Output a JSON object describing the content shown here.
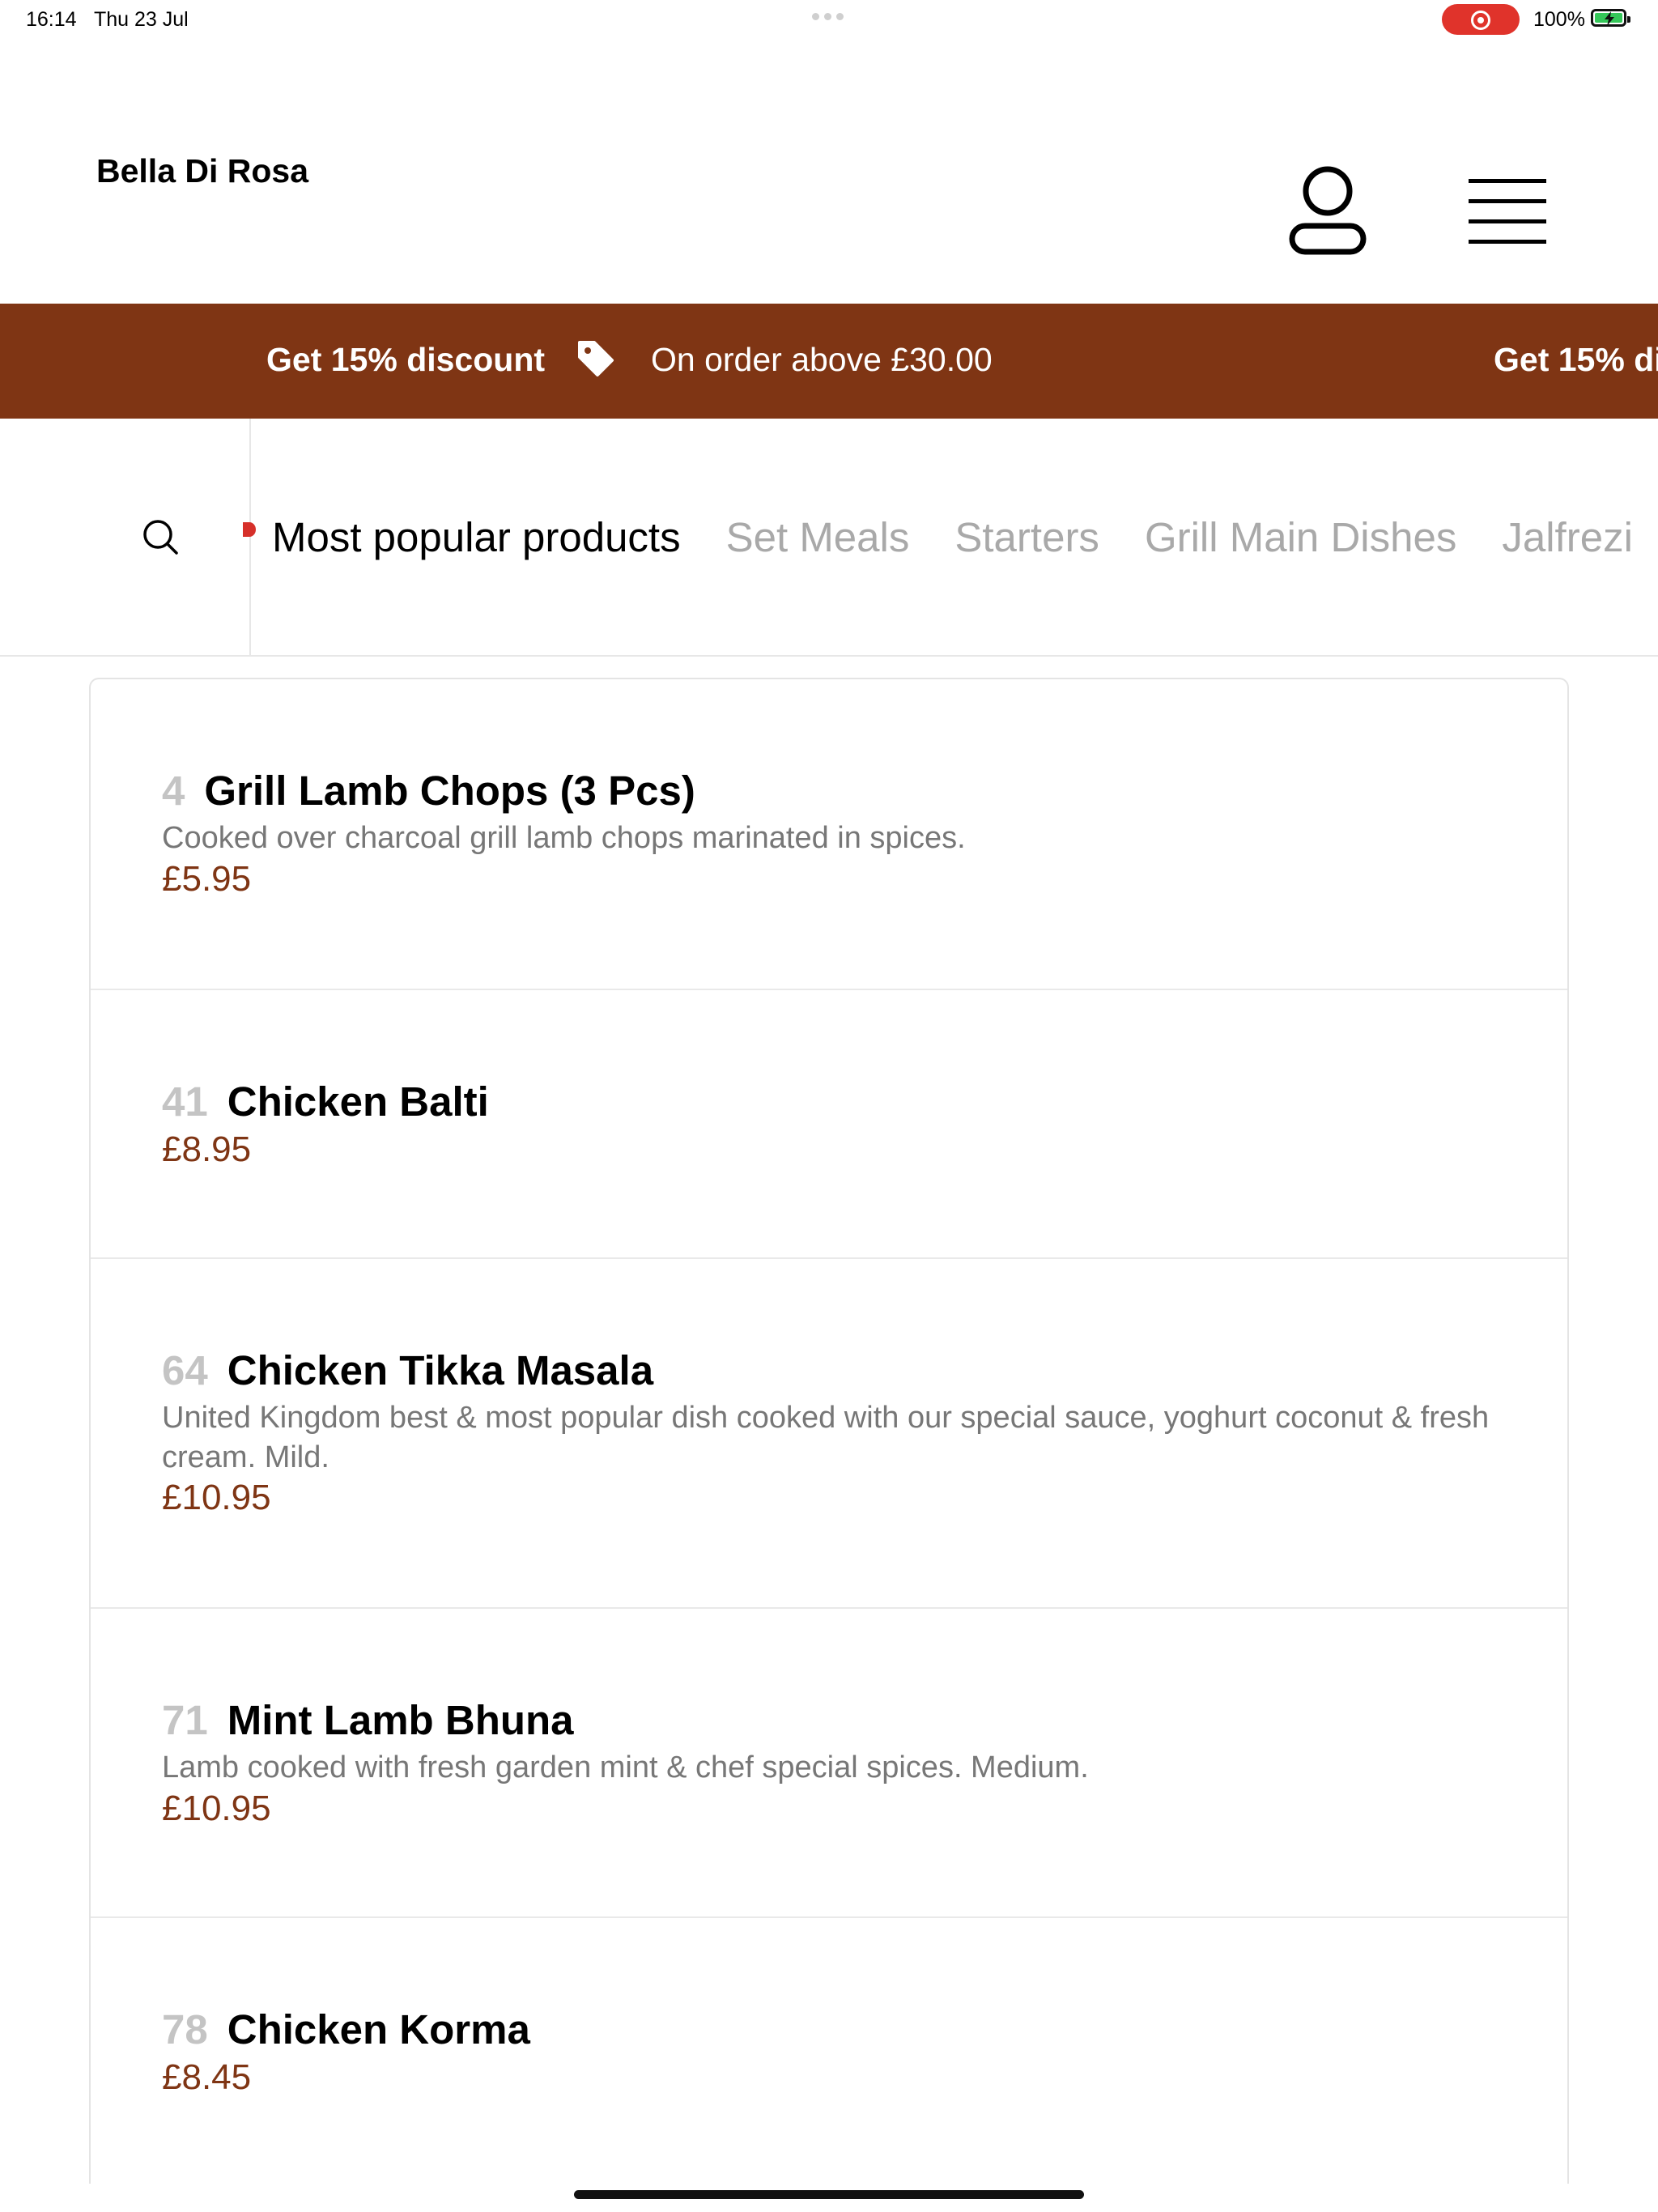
{
  "status_bar": {
    "time": "16:14",
    "date": "Thu 23 Jul",
    "battery": "100%"
  },
  "header": {
    "brand": "Bella Di Rosa",
    "account_icon": "user-icon",
    "menu_icon": "hamburger-menu-icon"
  },
  "promo": {
    "title": "Get 15% discount",
    "icon": "tag-icon",
    "condition": "On order above £30.00",
    "title_repeat": "Get 15% di"
  },
  "category_nav": {
    "search_icon": "search-icon",
    "tabs": [
      {
        "label": "Most popular products",
        "active": true
      },
      {
        "label": "Set Meals",
        "active": false
      },
      {
        "label": "Starters",
        "active": false
      },
      {
        "label": "Grill Main Dishes",
        "active": false
      },
      {
        "label": "Jalfrezi",
        "active": false
      }
    ]
  },
  "products": [
    {
      "number": "4",
      "name": "Grill Lamb Chops (3 Pcs)",
      "description": "Cooked over charcoal grill lamb chops marinated in spices.",
      "price": "£5.95"
    },
    {
      "number": "41",
      "name": "Chicken Balti",
      "description": "",
      "price": "£8.95"
    },
    {
      "number": "64",
      "name": "Chicken Tikka Masala",
      "description": "United Kingdom best & most popular dish cooked with our special sauce, yoghurt coconut & fresh cream. Mild.",
      "price": "£10.95"
    },
    {
      "number": "71",
      "name": "Mint Lamb Bhuna",
      "description": "Lamb cooked with fresh garden mint & chef special spices. Medium.",
      "price": "£10.95"
    },
    {
      "number": "78",
      "name": "Chicken Korma",
      "description": "",
      "price": "£8.45"
    }
  ],
  "colors": {
    "brand": "#7f3514",
    "inactive_tab": "#a9a9a9",
    "description": "#777777"
  }
}
